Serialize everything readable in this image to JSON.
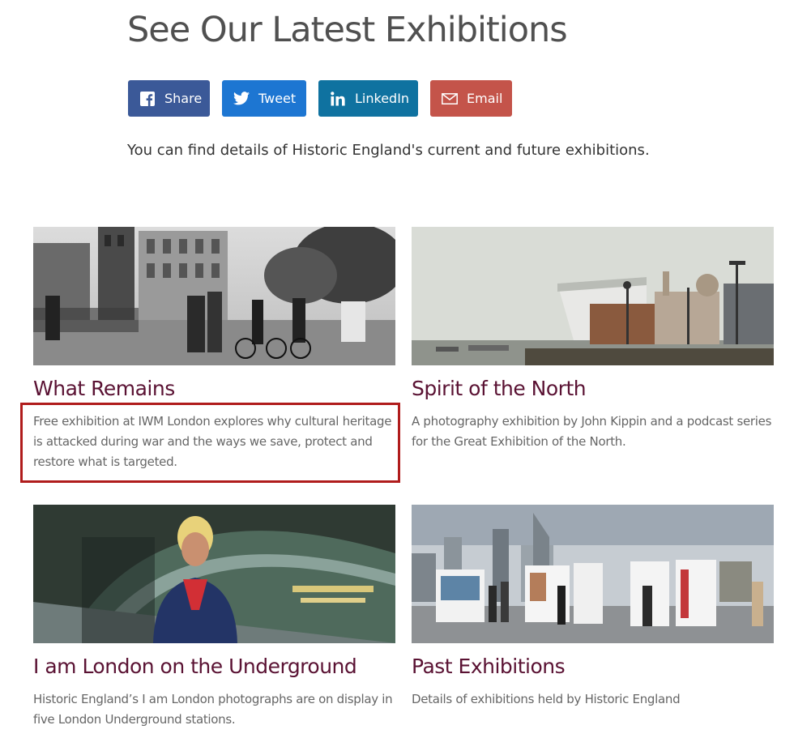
{
  "page": {
    "title": "See Our Latest Exhibitions",
    "intro": "You can find details of Historic England's current and future exhibitions."
  },
  "share": {
    "facebook": "Share",
    "twitter": "Tweet",
    "linkedin": "LinkedIn",
    "email": "Email",
    "colors": {
      "facebook": "#3b5998",
      "twitter": "#1d76d2",
      "linkedin": "#0f72a0",
      "email": "#c4544a"
    }
  },
  "cards": [
    {
      "title": "What Remains",
      "description": "Free exhibition at IWM London explores why cultural heritage is attacked during war and the ways we save, protect and restore what is targeted.",
      "highlighted": true
    },
    {
      "title": "Spirit of the North",
      "description": "A photography exhibition by John Kippin and a podcast series for the Great Exhibition of the North."
    },
    {
      "title": "I am London on the Underground",
      "description": "Historic England’s I am London photographs are on display in five London Underground stations."
    },
    {
      "title": "Past Exhibitions",
      "description": "Details of exhibitions held by Historic England"
    }
  ],
  "colors": {
    "card_title": "#5a1233",
    "highlight": "#b01c1c"
  }
}
